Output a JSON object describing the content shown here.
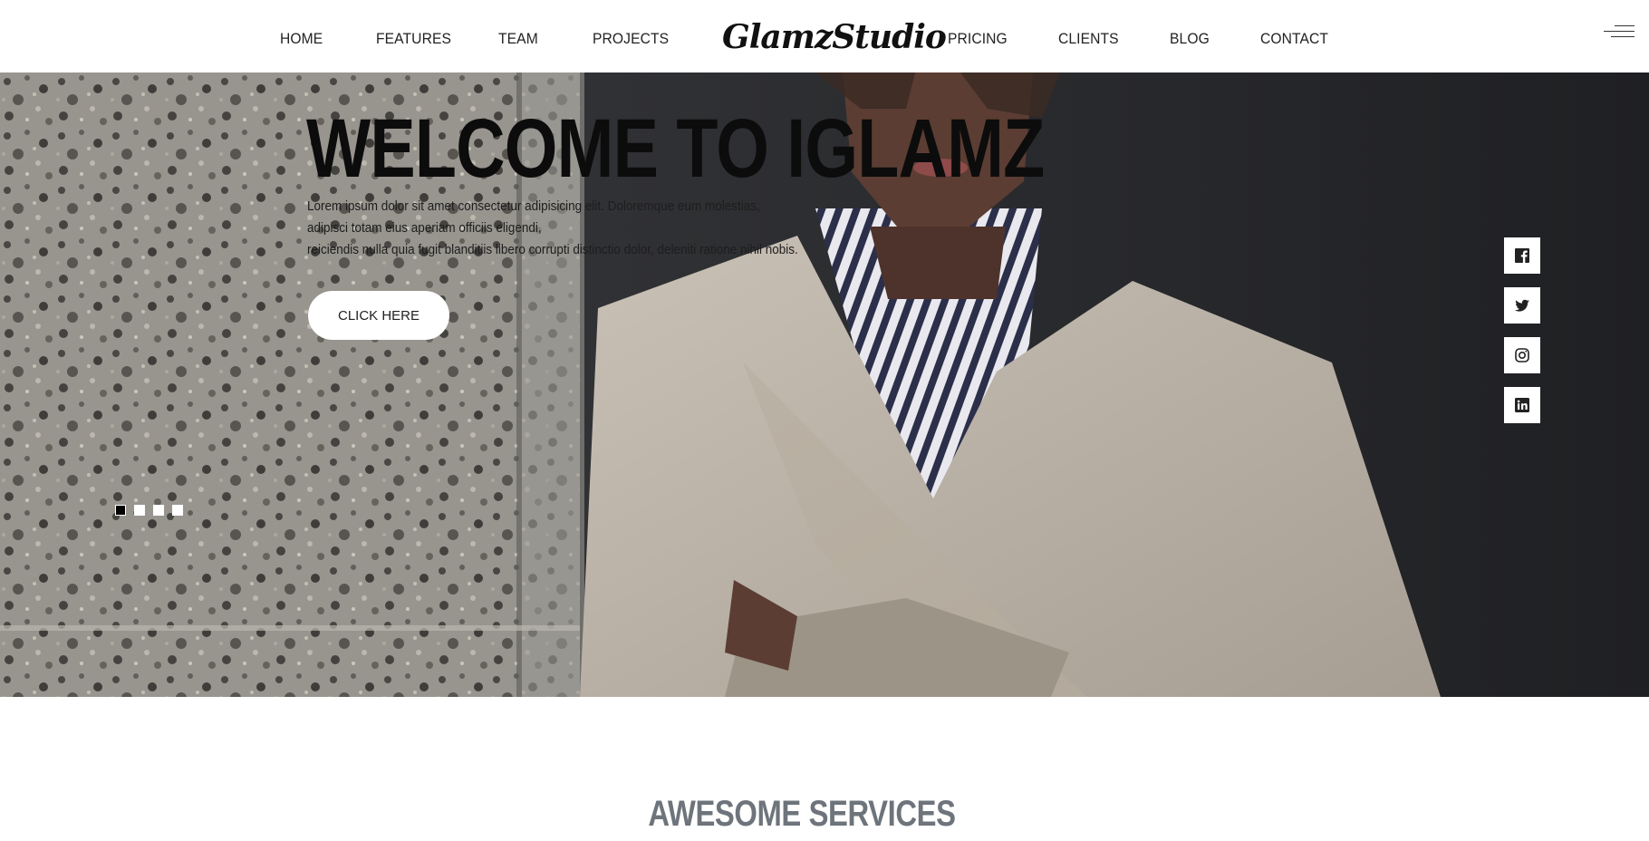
{
  "nav": {
    "left": [
      "HOME",
      "FEATURES",
      "TEAM",
      "PROJECTS"
    ],
    "logo": "GlamzStudio",
    "right": [
      "PRICING",
      "CLIENTS",
      "BLOG",
      "CONTACT"
    ],
    "menu_icon": "hamburger-menu-icon"
  },
  "hero": {
    "title": "WELCOME TO IGLAMZ",
    "text_lines": [
      "Lorem ipsum dolor sit amet consectetur adipisicing elit. Doloremque eum molestias,",
      "adipisci totam eius aperiam officiis eligendi,",
      "reiciendis nulla quia fugit blanditiis libero corrupti distinctio dolor, deleniti ratione nihil nobis."
    ],
    "cta_label": "CLICK HERE",
    "slides": {
      "count": 4,
      "active": 1
    }
  },
  "social": [
    {
      "name": "facebook",
      "icon": "facebook-icon"
    },
    {
      "name": "twitter",
      "icon": "twitter-icon"
    },
    {
      "name": "instagram",
      "icon": "instagram-icon"
    },
    {
      "name": "linkedin",
      "icon": "linkedin-icon"
    }
  ],
  "services": {
    "title": "AWESOME SERVICES"
  },
  "colors": {
    "active_dot": "#000000",
    "inactive_dot": "#ffffff",
    "services_title": "#6e747b"
  }
}
